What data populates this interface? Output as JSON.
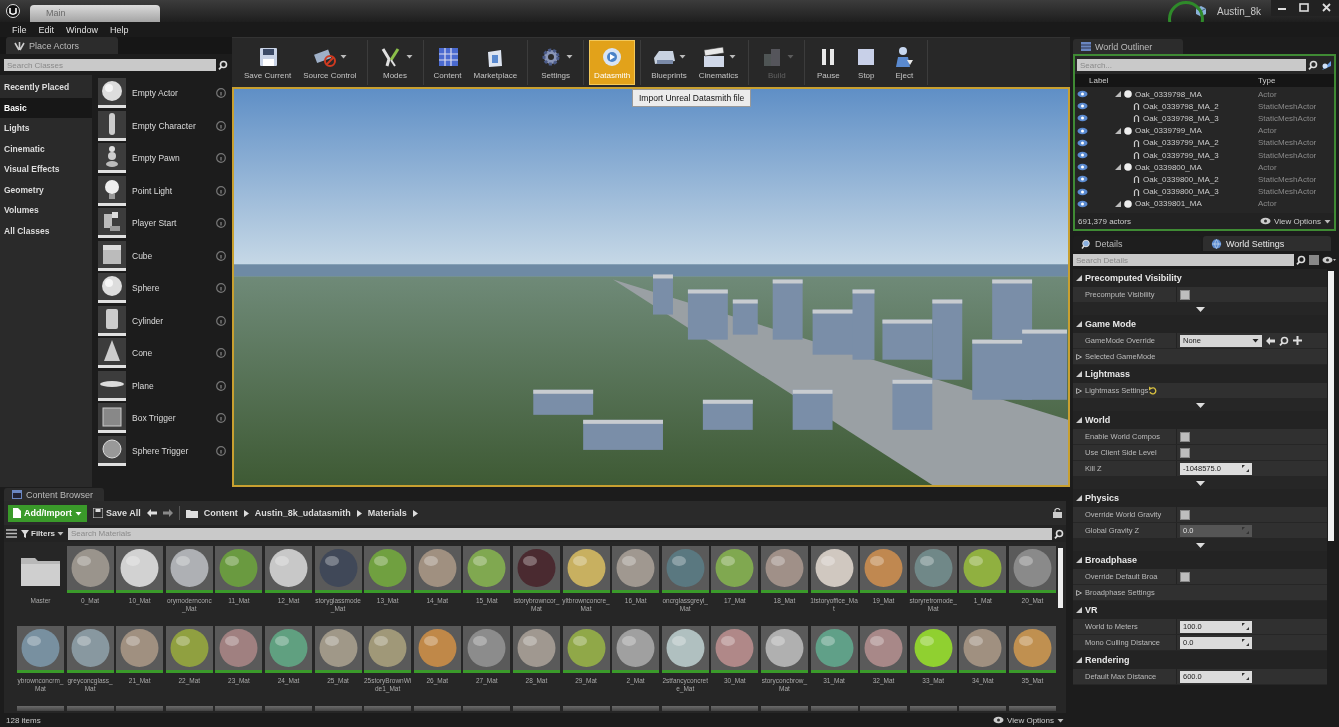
{
  "title_bar": {
    "tab": "Main",
    "project": "Austin_8k"
  },
  "menu": [
    "File",
    "Edit",
    "Window",
    "Help"
  ],
  "place_actors": {
    "title": "Place Actors",
    "search": {
      "placeholder": "Search Classes"
    },
    "categories": [
      {
        "label": "Recently Placed",
        "selected": false
      },
      {
        "label": "Basic",
        "selected": true
      },
      {
        "label": "Lights",
        "selected": false
      },
      {
        "label": "Cinematic",
        "selected": false
      },
      {
        "label": "Visual Effects",
        "selected": false
      },
      {
        "label": "Geometry",
        "selected": false
      },
      {
        "label": "Volumes",
        "selected": false
      },
      {
        "label": "All Classes",
        "selected": false
      }
    ],
    "actors": [
      {
        "label": "Empty Actor",
        "kind": "sphere"
      },
      {
        "label": "Empty Character",
        "kind": "character"
      },
      {
        "label": "Empty Pawn",
        "kind": "pawn"
      },
      {
        "label": "Point Light",
        "kind": "light"
      },
      {
        "label": "Player Start",
        "kind": "player"
      },
      {
        "label": "Cube",
        "kind": "cube"
      },
      {
        "label": "Sphere",
        "kind": "sphere"
      },
      {
        "label": "Cylinder",
        "kind": "cylinder"
      },
      {
        "label": "Cone",
        "kind": "cone"
      },
      {
        "label": "Plane",
        "kind": "plane"
      },
      {
        "label": "Box Trigger",
        "kind": "box-trigger"
      },
      {
        "label": "Sphere Trigger",
        "kind": "sphere-trigger"
      }
    ]
  },
  "toolbar": {
    "groups": [
      {
        "buttons": [
          {
            "label": "Save Current",
            "kind": "save",
            "dropdown": false,
            "selected": false,
            "disabled": false
          },
          {
            "label": "Source Control",
            "kind": "source-control",
            "dropdown": true,
            "selected": false,
            "disabled": false
          }
        ]
      },
      {
        "buttons": [
          {
            "label": "Modes",
            "kind": "modes",
            "dropdown": true,
            "selected": false,
            "disabled": false
          }
        ]
      },
      {
        "buttons": [
          {
            "label": "Content",
            "kind": "content",
            "dropdown": false,
            "selected": false,
            "disabled": false
          },
          {
            "label": "Marketplace",
            "kind": "marketplace",
            "dropdown": false,
            "selected": false,
            "disabled": false
          }
        ]
      },
      {
        "buttons": [
          {
            "label": "Settings",
            "kind": "settings",
            "dropdown": true,
            "selected": false,
            "disabled": false
          }
        ]
      },
      {
        "buttons": [
          {
            "label": "Datasmith",
            "kind": "datasmith",
            "dropdown": false,
            "selected": true,
            "disabled": false
          }
        ]
      },
      {
        "buttons": [
          {
            "label": "Blueprints",
            "kind": "blueprints",
            "dropdown": true,
            "selected": false,
            "disabled": false
          },
          {
            "label": "Cinematics",
            "kind": "cinematics",
            "dropdown": true,
            "selected": false,
            "disabled": false
          }
        ]
      },
      {
        "buttons": [
          {
            "label": "Build",
            "kind": "build",
            "dropdown": true,
            "selected": false,
            "disabled": true
          }
        ]
      },
      {
        "buttons": [
          {
            "label": "Pause",
            "kind": "pause",
            "dropdown": false,
            "selected": false,
            "disabled": false
          },
          {
            "label": "Stop",
            "kind": "stop",
            "dropdown": false,
            "selected": false,
            "disabled": false
          },
          {
            "label": "Eject",
            "kind": "eject",
            "dropdown": false,
            "selected": false,
            "disabled": false
          }
        ]
      }
    ],
    "tooltip": "Import Unreal Datasmith file"
  },
  "outliner": {
    "title": "World Outliner",
    "search": {
      "placeholder": "Search..."
    },
    "columns": [
      "Label",
      "Type"
    ],
    "rows": [
      {
        "label": "Oak_0339798_MA",
        "type": "Actor",
        "expanded": true,
        "children": [
          {
            "label": "Oak_0339798_MA_2",
            "type": "StaticMeshActor"
          },
          {
            "label": "Oak_0339798_MA_3",
            "type": "StaticMeshActor"
          }
        ]
      },
      {
        "label": "Oak_0339799_MA",
        "type": "Actor",
        "expanded": true,
        "children": [
          {
            "label": "Oak_0339799_MA_2",
            "type": "StaticMeshActor"
          },
          {
            "label": "Oak_0339799_MA_3",
            "type": "StaticMeshActor"
          }
        ]
      },
      {
        "label": "Oak_0339800_MA",
        "type": "Actor",
        "expanded": true,
        "children": [
          {
            "label": "Oak_0339800_MA_2",
            "type": "StaticMeshActor"
          },
          {
            "label": "Oak_0339800_MA_3",
            "type": "StaticMeshActor"
          }
        ]
      },
      {
        "label": "Oak_0339801_MA",
        "type": "Actor",
        "expanded": true,
        "children": []
      }
    ],
    "count": "691,379 actors",
    "view_options": "View Options"
  },
  "details": {
    "tabs": [
      {
        "label": "Details",
        "selected": false
      },
      {
        "label": "World Settings",
        "selected": true
      }
    ],
    "search": {
      "placeholder": "Search Details"
    },
    "sections": [
      {
        "title": "Precomputed Visibility",
        "expanded": true,
        "advanced": true,
        "properties": [
          {
            "kind": "checkbox",
            "label": "Precompute Visibility",
            "checked": false
          }
        ]
      },
      {
        "title": "Game Mode",
        "expanded": true,
        "advanced": false,
        "properties": [
          {
            "kind": "dropdown",
            "label": "GameMode Override",
            "value": "None"
          },
          {
            "kind": "group",
            "label": "Selected GameMode",
            "modified": false
          }
        ]
      },
      {
        "title": "Lightmass",
        "expanded": true,
        "advanced": true,
        "properties": [
          {
            "kind": "group",
            "label": "Lightmass Settings",
            "modified": true
          }
        ]
      },
      {
        "title": "World",
        "expanded": true,
        "advanced": true,
        "properties": [
          {
            "kind": "checkbox",
            "label": "Enable World Compos",
            "checked": false
          },
          {
            "kind": "checkbox",
            "label": "Use Client Side Level",
            "checked": false
          },
          {
            "kind": "number",
            "label": "Kill Z",
            "value": "-1048575.0",
            "disabled": false
          }
        ]
      },
      {
        "title": "Physics",
        "expanded": true,
        "advanced": true,
        "properties": [
          {
            "kind": "checkbox",
            "label": "Override World Gravity",
            "checked": false
          },
          {
            "kind": "number",
            "label": "Global Gravity Z",
            "value": "0.0",
            "disabled": true
          }
        ]
      },
      {
        "title": "Broadphase",
        "expanded": true,
        "advanced": false,
        "properties": [
          {
            "kind": "checkbox",
            "label": "Override Default Broa",
            "checked": false
          },
          {
            "kind": "group",
            "label": "Broadphase Settings",
            "modified": false
          }
        ]
      },
      {
        "title": "VR",
        "expanded": true,
        "advanced": false,
        "properties": [
          {
            "kind": "number",
            "label": "World to Meters",
            "value": "100.0",
            "disabled": false
          },
          {
            "kind": "number",
            "label": "Mono Culling Distance",
            "value": "0.0",
            "disabled": false
          }
        ]
      },
      {
        "title": "Rendering",
        "expanded": true,
        "advanced": false,
        "properties": [
          {
            "kind": "number",
            "label": "Default Max Distance",
            "value": "600.0",
            "disabled": false
          }
        ]
      }
    ]
  },
  "content_browser": {
    "title": "Content Browser",
    "add_button": "Add/Import",
    "save_all": "Save All",
    "path": [
      "Content",
      "Austin_8k_udatasmith",
      "Materials"
    ],
    "filters": "Filters",
    "search": {
      "placeholder": "Search Materials"
    },
    "assets": [
      {
        "kind": "folder",
        "label": "Master"
      },
      {
        "kind": "material",
        "label": "0_Mat",
        "color": "#9a948c"
      },
      {
        "kind": "material",
        "label": "10_Mat",
        "color": "#d2d2d2"
      },
      {
        "kind": "material",
        "label": "orymodernconc_Mat",
        "color": "#aeb0b4"
      },
      {
        "kind": "material",
        "label": "11_Mat",
        "color": "#6a9a40"
      },
      {
        "kind": "material",
        "label": "12_Mat",
        "color": "#c8c8c8"
      },
      {
        "kind": "material",
        "label": "storyglassmode_Mat",
        "color": "#404858"
      },
      {
        "kind": "material",
        "label": "13_Mat",
        "color": "#70a040"
      },
      {
        "kind": "material",
        "label": "14_Mat",
        "color": "#a09080"
      },
      {
        "kind": "material",
        "label": "15_Mat",
        "color": "#80a850"
      },
      {
        "kind": "material",
        "label": "istorybrowncor_Mat",
        "color": "#4a2a30"
      },
      {
        "kind": "material",
        "label": "yltbrownconcre_Mat",
        "color": "#c8b060"
      },
      {
        "kind": "material",
        "label": "16_Mat",
        "color": "#a09890"
      },
      {
        "kind": "material",
        "label": "oncrglassgreyl_Mat",
        "color": "#5a7880"
      },
      {
        "kind": "material",
        "label": "17_Mat",
        "color": "#80a850"
      },
      {
        "kind": "material",
        "label": "18_Mat",
        "color": "#a09088"
      },
      {
        "kind": "material",
        "label": "1tstoryoffice_Mat",
        "color": "#d0c8c0"
      },
      {
        "kind": "material",
        "label": "19_Mat",
        "color": "#c08850"
      },
      {
        "kind": "material",
        "label": "storyretromode_Mat",
        "color": "#708888"
      },
      {
        "kind": "material",
        "label": "1_Mat",
        "color": "#90b040"
      },
      {
        "kind": "material",
        "label": "20_Mat",
        "color": "#8a8a8a"
      },
      {
        "kind": "material",
        "label": "ybrownconcrm_Mat",
        "color": "#7890a0"
      },
      {
        "kind": "material",
        "label": "greyconcglass_Mat",
        "color": "#8898a0"
      },
      {
        "kind": "material",
        "label": "21_Mat",
        "color": "#a09080"
      },
      {
        "kind": "material",
        "label": "22_Mat",
        "color": "#90a040"
      },
      {
        "kind": "material",
        "label": "23_Mat",
        "color": "#a08080"
      },
      {
        "kind": "material",
        "label": "24_Mat",
        "color": "#60a080"
      },
      {
        "kind": "material",
        "label": "25_Mat",
        "color": "#a09888"
      },
      {
        "kind": "material",
        "label": "25storyBrownWide1_Mat",
        "color": "#a09878"
      },
      {
        "kind": "material",
        "label": "26_Mat",
        "color": "#c08848"
      },
      {
        "kind": "material",
        "label": "27_Mat",
        "color": "#8c8c8c"
      },
      {
        "kind": "material",
        "label": "28_Mat",
        "color": "#a09890"
      },
      {
        "kind": "material",
        "label": "29_Mat",
        "color": "#90a848"
      },
      {
        "kind": "material",
        "label": "2_Mat",
        "color": "#a0a0a0"
      },
      {
        "kind": "material",
        "label": "2stfancyconcrete_Mat",
        "color": "#b0c0c0"
      },
      {
        "kind": "material",
        "label": "30_Mat",
        "color": "#b08888"
      },
      {
        "kind": "material",
        "label": "storyconcbrow_Mat",
        "color": "#b0b0b0"
      },
      {
        "kind": "material",
        "label": "31_Mat",
        "color": "#60a088"
      },
      {
        "kind": "material",
        "label": "32_Mat",
        "color": "#a88888"
      },
      {
        "kind": "material",
        "label": "33_Mat",
        "color": "#90d030"
      },
      {
        "kind": "material",
        "label": "34_Mat",
        "color": "#a09080"
      },
      {
        "kind": "material",
        "label": "35_Mat",
        "color": "#c09050"
      }
    ],
    "count": "128 items",
    "view_options": "View Options"
  }
}
